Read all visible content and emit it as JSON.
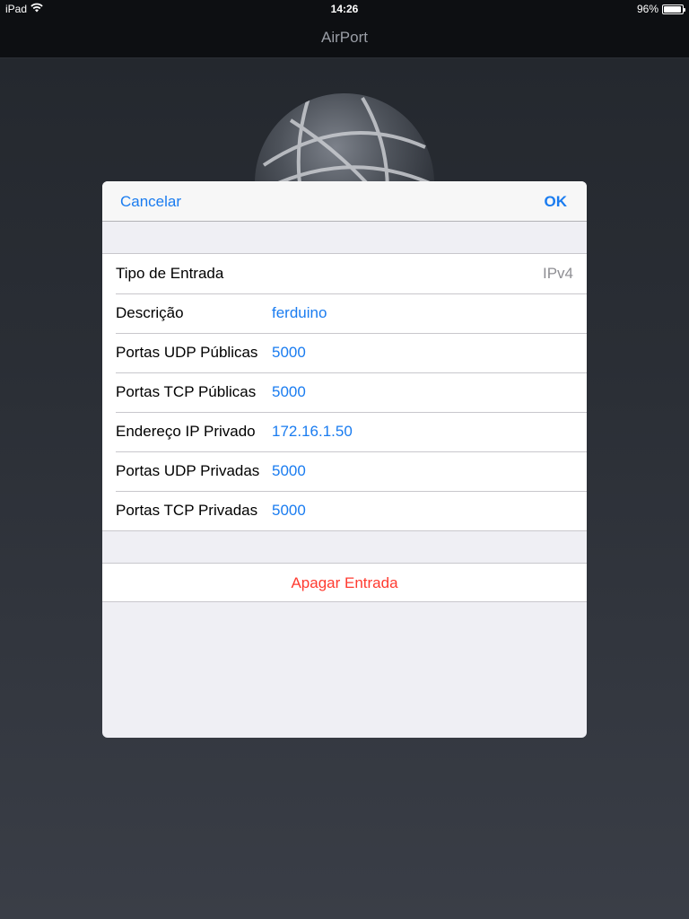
{
  "status_bar": {
    "device": "iPad",
    "time": "14:26",
    "battery": "96%",
    "battery_level": 0.96
  },
  "nav": {
    "title": "AirPort"
  },
  "modal": {
    "cancel_label": "Cancelar",
    "ok_label": "OK",
    "rows": [
      {
        "label": "Tipo de Entrada",
        "value": "IPv4"
      },
      {
        "label": "Descrição",
        "value": "ferduino"
      },
      {
        "label": "Portas UDP Públicas",
        "value": "5000"
      },
      {
        "label": "Portas TCP Públicas",
        "value": "5000"
      },
      {
        "label": "Endereço IP Privado",
        "value": "172.16.1.50"
      },
      {
        "label": "Portas UDP Privadas",
        "value": "5000"
      },
      {
        "label": "Portas TCP Privadas",
        "value": "5000"
      }
    ],
    "delete_label": "Apagar Entrada"
  },
  "colors": {
    "accent": "#1a7cf0",
    "destructive": "#ff3b30"
  }
}
